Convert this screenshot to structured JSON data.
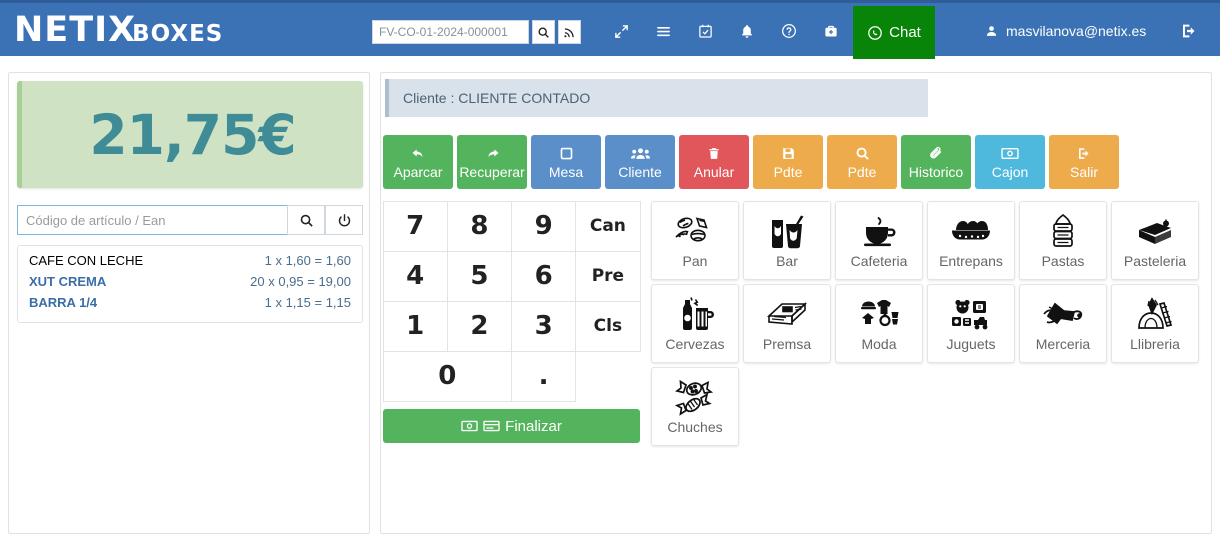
{
  "header": {
    "logo_main": "NETIX",
    "logo_sub": "BOXES",
    "search_placeholder": "FV-CO-01-2024-000001",
    "search_value": "",
    "search_button": "search-icon",
    "rss_button": "rss-icon",
    "icons": [
      {
        "name": "expand-icon",
        "label": "expand"
      },
      {
        "name": "menu-icon",
        "label": "menu"
      },
      {
        "name": "calendar-check-icon",
        "label": "calendar"
      },
      {
        "name": "bell-icon",
        "label": "notifications"
      },
      {
        "name": "help-circle-icon",
        "label": "help"
      },
      {
        "name": "briefcase-medical-icon",
        "label": "support"
      }
    ],
    "chat_label": "Chat",
    "user_email": "masvilanova@netix.es",
    "logout_label": "logout"
  },
  "left": {
    "total": "21,75€",
    "code_placeholder": "Código de artículo / Ean",
    "code_value": "",
    "items": [
      {
        "name": "CAFE CON LECHE",
        "calc": "1 x 1,60 = 1,60"
      },
      {
        "name": "XUT  CREMA",
        "calc": "20 x 0,95 = 19,00"
      },
      {
        "name": "BARRA 1/4",
        "calc": "1 x 1,15 = 1,15"
      }
    ]
  },
  "main": {
    "client_line": "Cliente : CLIENTE CONTADO",
    "actions": [
      {
        "label": "Aparcar",
        "icon": "arrow-undo-icon",
        "color": "green"
      },
      {
        "label": "Recuperar",
        "icon": "arrow-redo-icon",
        "color": "green"
      },
      {
        "label": "Mesa",
        "icon": "square-icon",
        "color": "blue"
      },
      {
        "label": "Cliente",
        "icon": "users-icon",
        "color": "blue"
      },
      {
        "label": "Anular",
        "icon": "trash-icon",
        "color": "red"
      },
      {
        "label": "Pdte",
        "icon": "save-icon",
        "color": "orange"
      },
      {
        "label": "Pdte",
        "icon": "search-icon",
        "color": "orange"
      },
      {
        "label": "Historico",
        "icon": "paperclip-icon",
        "color": "green"
      },
      {
        "label": "Cajon",
        "icon": "money-bill-icon",
        "color": "cyan"
      },
      {
        "label": "Salir",
        "icon": "sign-out-icon",
        "color": "orange"
      }
    ],
    "keypad": [
      "7",
      "8",
      "9",
      "Can",
      "4",
      "5",
      "6",
      "Pre",
      "1",
      "2",
      "3",
      "Cls",
      "0",
      "."
    ],
    "finalizar_label": "Finalizar",
    "categories": [
      {
        "label": "Pan",
        "icon": "bread-icon"
      },
      {
        "label": "Bar",
        "icon": "drinks-icon"
      },
      {
        "label": "Cafeteria",
        "icon": "coffee-cup-icon"
      },
      {
        "label": "Entrepans",
        "icon": "sandwich-icon"
      },
      {
        "label": "Pastas",
        "icon": "pastry-stack-icon"
      },
      {
        "label": "Pasteleria",
        "icon": "cake-slice-icon"
      },
      {
        "label": "Cervezas",
        "icon": "beer-icon"
      },
      {
        "label": "Premsa",
        "icon": "newspaper-icon"
      },
      {
        "label": "Moda",
        "icon": "fashion-icon"
      },
      {
        "label": "Juguets",
        "icon": "toys-icon"
      },
      {
        "label": "Merceria",
        "icon": "sewing-icon"
      },
      {
        "label": "Llibreria",
        "icon": "stationery-icon"
      },
      {
        "label": "Chuches",
        "icon": "candy-icon"
      }
    ]
  },
  "colors": {
    "header_blue": "#3b72b5",
    "chat_green": "#088508",
    "total_bg": "#cfe3c4",
    "total_text": "#3f8c96",
    "action_green": "#54b45e",
    "action_blue": "#5b8fc9",
    "action_red": "#e0565a",
    "action_orange": "#eeab4b",
    "action_cyan": "#4fb8dd"
  }
}
